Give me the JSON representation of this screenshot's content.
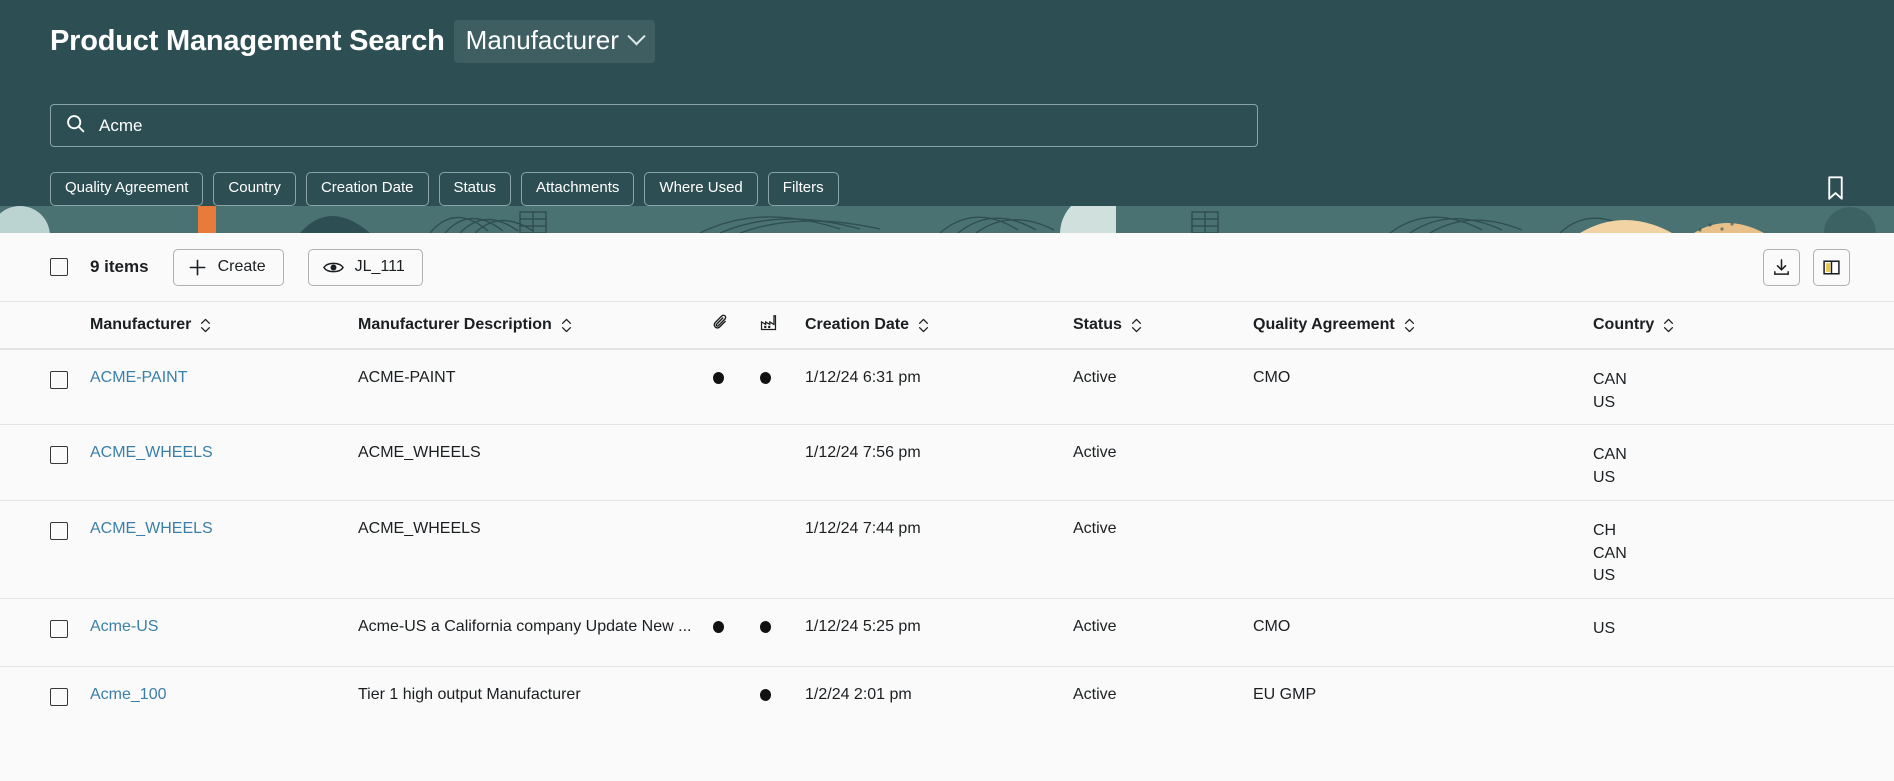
{
  "header": {
    "app_title": "Product Management Search",
    "entity_select": {
      "label": "Manufacturer",
      "icon": "chevron-down-icon"
    },
    "search": {
      "value": "Acme",
      "placeholder": "Search",
      "icon": "search-icon"
    },
    "chips": [
      {
        "label": "Quality Agreement"
      },
      {
        "label": "Country"
      },
      {
        "label": "Creation Date"
      },
      {
        "label": "Status"
      },
      {
        "label": "Attachments"
      },
      {
        "label": "Where Used"
      },
      {
        "label": "Filters"
      }
    ],
    "bookmark": {
      "icon": "bookmark-icon",
      "label": "Bookmark"
    },
    "background_color": "#2d4f53"
  },
  "toolbar": {
    "select_all": {
      "icon": "checkbox-unchecked-icon",
      "checked": false
    },
    "item_count": "9 items",
    "create_label": "Create",
    "create_icon": "plus-icon",
    "view_label": "JL_111",
    "view_icon": "eye-icon",
    "download": {
      "icon": "download-icon",
      "label": "Download"
    },
    "columns": {
      "icon": "columns-icon",
      "label": "Columns"
    }
  },
  "table": {
    "columns": [
      {
        "key": "manufacturer",
        "label": "Manufacturer",
        "sortable": true,
        "icon": null
      },
      {
        "key": "description",
        "label": "Manufacturer Description",
        "sortable": true,
        "icon": null
      },
      {
        "key": "attachments",
        "label": "",
        "sortable": false,
        "icon": "paperclip-icon"
      },
      {
        "key": "factory",
        "label": "",
        "sortable": false,
        "icon": "factory-icon"
      },
      {
        "key": "creation_date",
        "label": "Creation Date",
        "sortable": true,
        "icon": null
      },
      {
        "key": "status",
        "label": "Status",
        "sortable": true,
        "icon": null
      },
      {
        "key": "quality_agreement",
        "label": "Quality Agreement",
        "sortable": true,
        "icon": null
      },
      {
        "key": "country",
        "label": "Country",
        "sortable": true,
        "icon": null
      }
    ],
    "rows": [
      {
        "checked": false,
        "manufacturer": "ACME-PAINT",
        "description": "ACME-PAINT",
        "attachments": true,
        "factory": true,
        "creation_date": "1/12/24 6:31 pm",
        "status": "Active",
        "quality_agreement": "CMO",
        "country": [
          "CAN",
          "US"
        ]
      },
      {
        "checked": false,
        "manufacturer": "ACME_WHEELS",
        "description": "ACME_WHEELS",
        "attachments": false,
        "factory": false,
        "creation_date": "1/12/24 7:56 pm",
        "status": "Active",
        "quality_agreement": "",
        "country": [
          "CAN",
          "US"
        ]
      },
      {
        "checked": false,
        "manufacturer": "ACME_WHEELS",
        "description": "ACME_WHEELS",
        "attachments": false,
        "factory": false,
        "creation_date": "1/12/24 7:44 pm",
        "status": "Active",
        "quality_agreement": "",
        "country": [
          "CH",
          "CAN",
          "US"
        ]
      },
      {
        "checked": false,
        "manufacturer": "Acme-US",
        "description": "Acme-US a California company Update New ...",
        "attachments": true,
        "factory": true,
        "creation_date": "1/12/24 5:25 pm",
        "status": "Active",
        "quality_agreement": "CMO",
        "country": [
          "US"
        ]
      },
      {
        "checked": false,
        "manufacturer": "Acme_100",
        "description": "Tier 1 high output Manufacturer",
        "attachments": false,
        "factory": true,
        "creation_date": "1/2/24 2:01 pm",
        "status": "Active",
        "quality_agreement": "EU GMP",
        "country": []
      }
    ]
  },
  "colors": {
    "header_bg": "#2d4f53",
    "link": "#3a7fa8",
    "page_bg": "#fafafa",
    "accent_orange": "#e87b3c",
    "accent_tan": "#e8c18a",
    "accent_light_teal": "#a9c8c6"
  }
}
